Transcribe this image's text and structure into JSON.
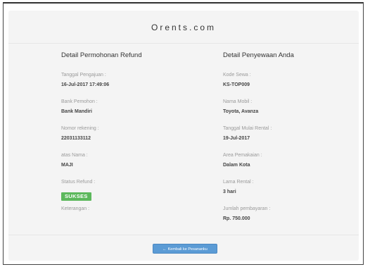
{
  "site": {
    "title": "Orents.com"
  },
  "refund": {
    "heading": "Detail Permohonan Refund",
    "fields": [
      {
        "label": "Tanggal Pengajuan :",
        "value": "16-Jul-2017 17:49:06"
      },
      {
        "label": "Bank Pemohon :",
        "value": "Bank Mandiri"
      },
      {
        "label": "Nomor rekening :",
        "value": "22031133112"
      },
      {
        "label": "atas Nama :",
        "value": "MAJI"
      }
    ],
    "status_label": "Status Refund :",
    "status_value": "SUKSES",
    "status_color": "#5cb85c",
    "note_label": "Keterangan :"
  },
  "rental": {
    "heading": "Detail Penyewaan Anda",
    "fields": [
      {
        "label": "Kode Sewa :",
        "value": "KS-TOP009"
      },
      {
        "label": "Nama Mobil :",
        "value": "Toyota, Avanza"
      },
      {
        "label": "Tanggal Mulai Rental :",
        "value": "19-Jul-2017"
      },
      {
        "label": "Area Pemakaian :",
        "value": "Dalam Kota"
      },
      {
        "label": "Lama Rental :",
        "value": "3 hari"
      },
      {
        "label": "Jumlah pembayaran :",
        "value": "Rp. 750.000"
      }
    ]
  },
  "footer": {
    "back_arrow": "←",
    "back_label": "Kembali ke Pesananku",
    "button_color": "#5b9bd5"
  }
}
